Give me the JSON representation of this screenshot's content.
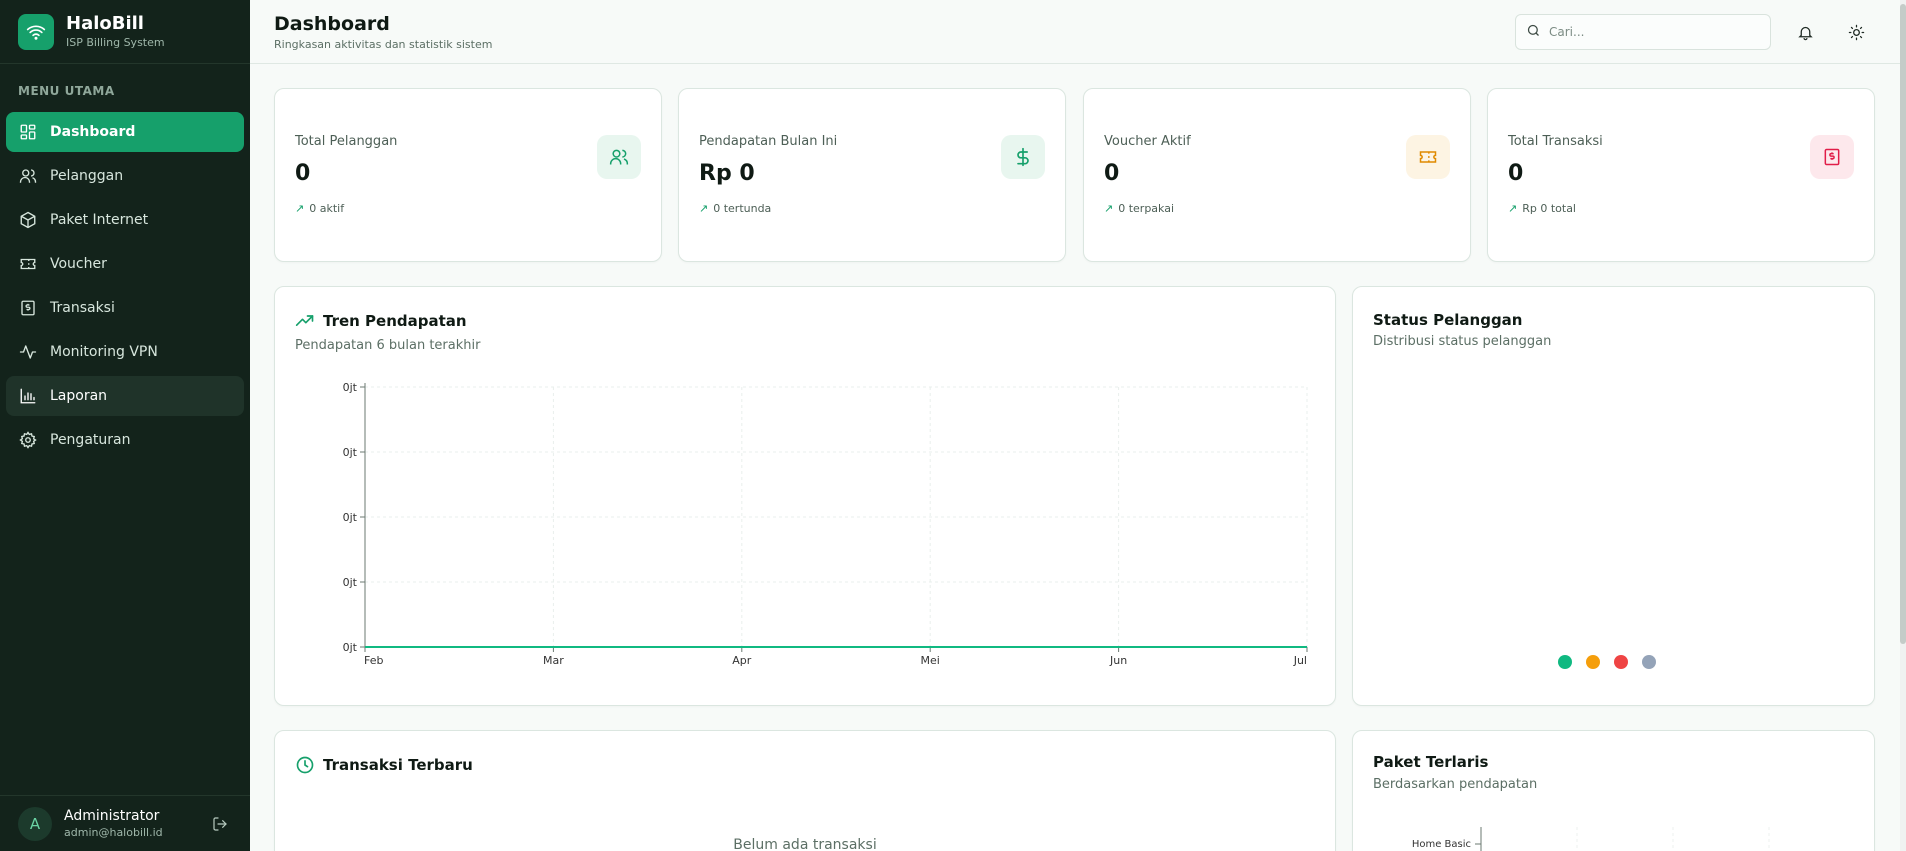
{
  "brand": {
    "name": "HaloBill",
    "subtitle": "ISP Billing System"
  },
  "sidebar": {
    "section_title": "MENU UTAMA",
    "items": [
      {
        "label": "Dashboard",
        "icon": "dashboard-icon"
      },
      {
        "label": "Pelanggan",
        "icon": "users-icon"
      },
      {
        "label": "Paket Internet",
        "icon": "package-icon"
      },
      {
        "label": "Voucher",
        "icon": "ticket-icon"
      },
      {
        "label": "Transaksi",
        "icon": "receipt-icon"
      },
      {
        "label": "Monitoring VPN",
        "icon": "activity-icon"
      },
      {
        "label": "Laporan",
        "icon": "bar-chart-icon"
      },
      {
        "label": "Pengaturan",
        "icon": "gear-icon"
      }
    ],
    "active_item": "Dashboard",
    "hovered_item": "Laporan"
  },
  "user": {
    "initial": "A",
    "name": "Administrator",
    "email": "admin@halobill.id"
  },
  "header": {
    "title": "Dashboard",
    "subtitle": "Ringkasan aktivitas dan statistik sistem",
    "search_placeholder": "Cari..."
  },
  "stats": [
    {
      "title": "Total Pelanggan",
      "value": "0",
      "footnote": "0 aktif",
      "icon": "users-icon",
      "icon_color": "#16a06b",
      "icon_bg": "#e8f6ef"
    },
    {
      "title": "Pendapatan Bulan Ini",
      "value": "Rp 0",
      "footnote": "0 tertunda",
      "icon": "dollar-icon",
      "icon_color": "#16a06b",
      "icon_bg": "#e8f6ef"
    },
    {
      "title": "Voucher Aktif",
      "value": "0",
      "footnote": "0 terpakai",
      "icon": "ticket-icon",
      "icon_color": "#e08a00",
      "icon_bg": "#fdf4e3"
    },
    {
      "title": "Total Transaksi",
      "value": "0",
      "footnote": "Rp 0 total",
      "icon": "receipt-icon",
      "icon_color": "#e11d48",
      "icon_bg": "#fde8ec"
    }
  ],
  "revenue_panel": {
    "title": "Tren Pendapatan",
    "subtitle": "Pendapatan 6 bulan terakhir"
  },
  "status_panel": {
    "title": "Status Pelanggan",
    "subtitle": "Distribusi status pelanggan",
    "legend_colors": [
      "#10b981",
      "#f59e0b",
      "#ef4444",
      "#94a3b8"
    ]
  },
  "transactions_panel": {
    "title": "Transaksi Terbaru",
    "empty_text": "Belum ada transaksi"
  },
  "top_packages_panel": {
    "title": "Paket Terlaris",
    "subtitle": "Berdasarkan pendapatan",
    "first_label": "Home Basic"
  },
  "colors": {
    "accent": "#16a06b",
    "sidebar_bg": "#13231b"
  },
  "chart_data": {
    "type": "line",
    "title": "Tren Pendapatan",
    "x": [
      "Feb",
      "Mar",
      "Apr",
      "Mei",
      "Jun",
      "Jul"
    ],
    "series": [
      {
        "values": [
          0,
          0,
          0,
          0,
          0,
          0
        ]
      }
    ],
    "y_tick_labels": [
      "0jt",
      "0jt",
      "0jt",
      "0jt",
      "0jt"
    ],
    "grid": true,
    "line_color": "#10b981"
  }
}
